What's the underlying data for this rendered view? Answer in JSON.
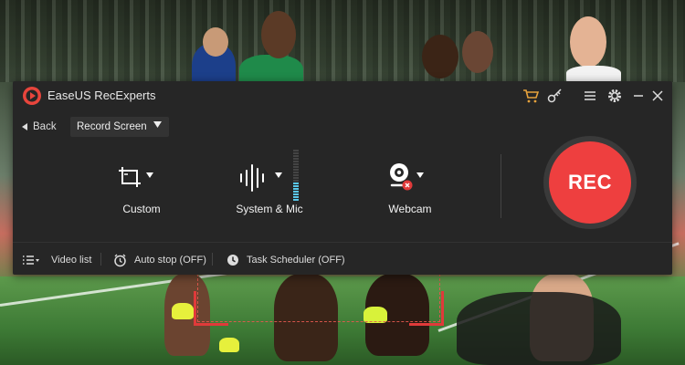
{
  "app": {
    "title": "EaseUS RecExperts",
    "logo_color": "#e8453c",
    "toolbar_icons": [
      "cart-icon",
      "key-icon",
      "menu-icon",
      "settings-icon",
      "minimize-icon",
      "close-icon"
    ]
  },
  "nav": {
    "back_label": "Back",
    "mode": "Record Screen"
  },
  "options": {
    "custom": {
      "label": "Custom",
      "icon": "crop-icon"
    },
    "audio": {
      "label": "System & Mic",
      "icon": "sound-wave-icon",
      "level": 0.35
    },
    "webcam": {
      "label": "Webcam",
      "icon": "webcam-icon",
      "status": "off"
    }
  },
  "rec": {
    "label": "REC",
    "color": "#ee3f3f"
  },
  "bottom": {
    "video_list": "Video list",
    "auto_stop": "Auto stop (OFF)",
    "task_scheduler": "Task Scheduler (OFF)"
  },
  "colors": {
    "panel": "#262626",
    "accent": "#e03a3a",
    "level_on": "#59c7e8"
  }
}
